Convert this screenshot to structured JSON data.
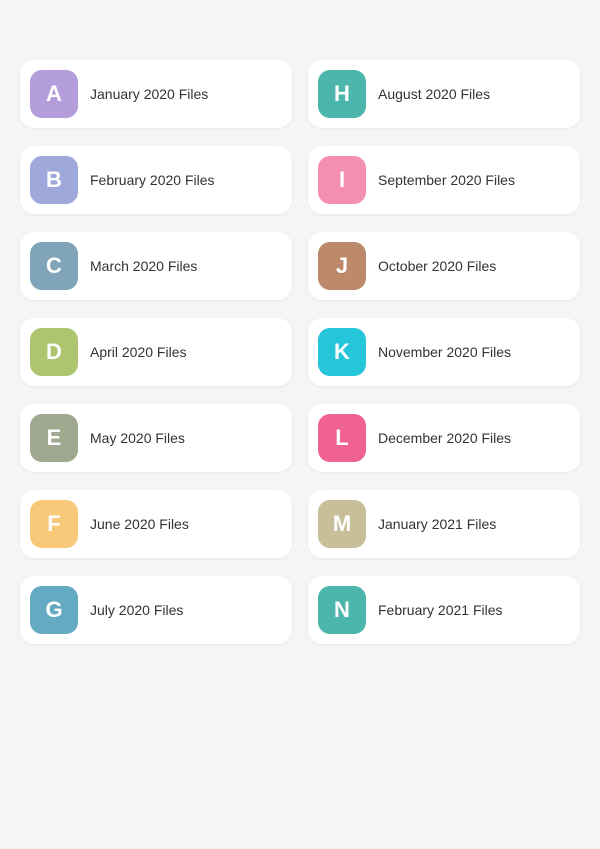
{
  "folders": [
    {
      "letter": "A",
      "label": "January 2020 Files",
      "colorClass": "color-a"
    },
    {
      "letter": "H",
      "label": "August 2020 Files",
      "colorClass": "color-h"
    },
    {
      "letter": "B",
      "label": "February 2020 Files",
      "colorClass": "color-b"
    },
    {
      "letter": "I",
      "label": "September 2020 Files",
      "colorClass": "color-i"
    },
    {
      "letter": "C",
      "label": "March 2020 Files",
      "colorClass": "color-c"
    },
    {
      "letter": "J",
      "label": "October 2020 Files",
      "colorClass": "color-j"
    },
    {
      "letter": "D",
      "label": "April 2020 Files",
      "colorClass": "color-d"
    },
    {
      "letter": "K",
      "label": "November 2020 Files",
      "colorClass": "color-k"
    },
    {
      "letter": "E",
      "label": "May 2020 Files",
      "colorClass": "color-e"
    },
    {
      "letter": "L",
      "label": "December 2020 Files",
      "colorClass": "color-l"
    },
    {
      "letter": "F",
      "label": "June 2020 Files",
      "colorClass": "color-f"
    },
    {
      "letter": "M",
      "label": "January 2021 Files",
      "colorClass": "color-m"
    },
    {
      "letter": "G",
      "label": "July 2020 Files",
      "colorClass": "color-g"
    },
    {
      "letter": "N",
      "label": "February 2021 Files",
      "colorClass": "color-n"
    }
  ]
}
